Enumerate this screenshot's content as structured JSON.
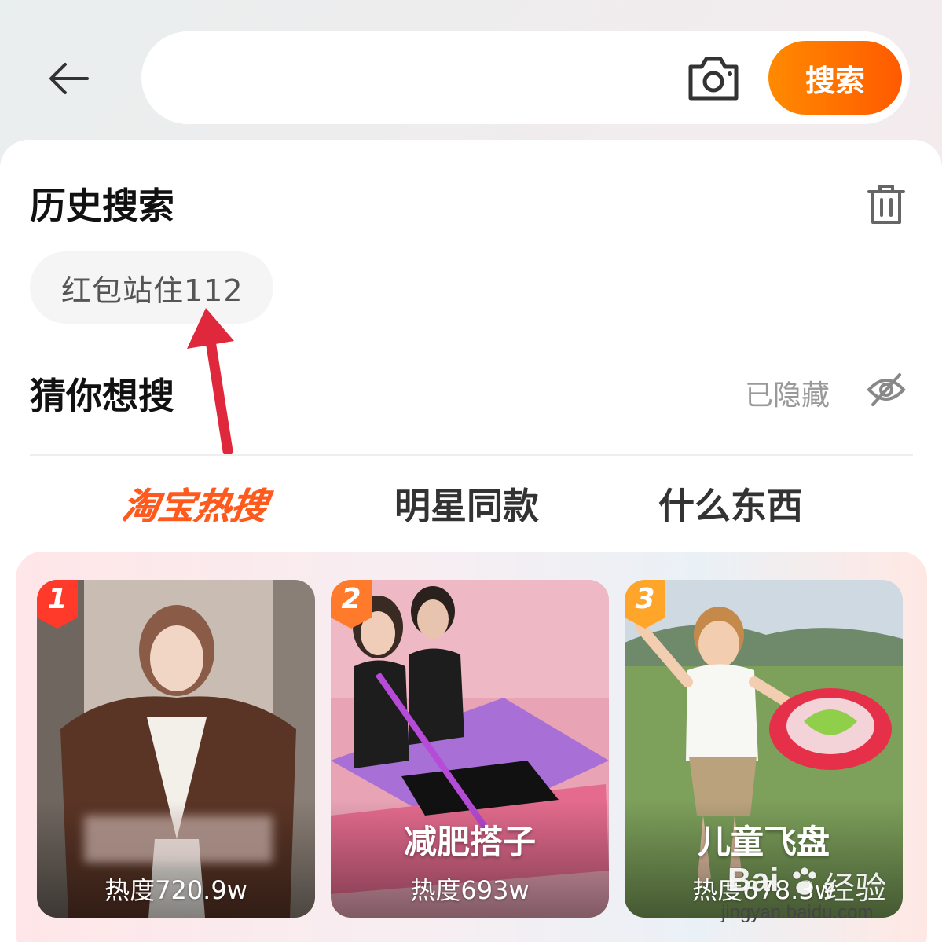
{
  "search": {
    "value": "",
    "button_label": "搜索"
  },
  "history": {
    "title": "历史搜索",
    "chips": [
      "红包站住112"
    ]
  },
  "guess": {
    "title": "猜你想搜",
    "hidden_label": "已隐藏"
  },
  "tabs": [
    "淘宝热搜",
    "明星同款",
    "什么东西"
  ],
  "hot_items": [
    {
      "rank": "1",
      "title": "",
      "heat": "热度720.9w"
    },
    {
      "rank": "2",
      "title": "减肥搭子",
      "heat": "热度693w"
    },
    {
      "rank": "3",
      "title": "儿童飞盘",
      "heat": "热度678.3w"
    }
  ],
  "watermark": {
    "brand": "Bai",
    "cn": "经验",
    "url": "jingyan.baidu.com"
  },
  "colors": {
    "accent": "#ff5a00",
    "annotation_arrow": "#e0283c"
  }
}
